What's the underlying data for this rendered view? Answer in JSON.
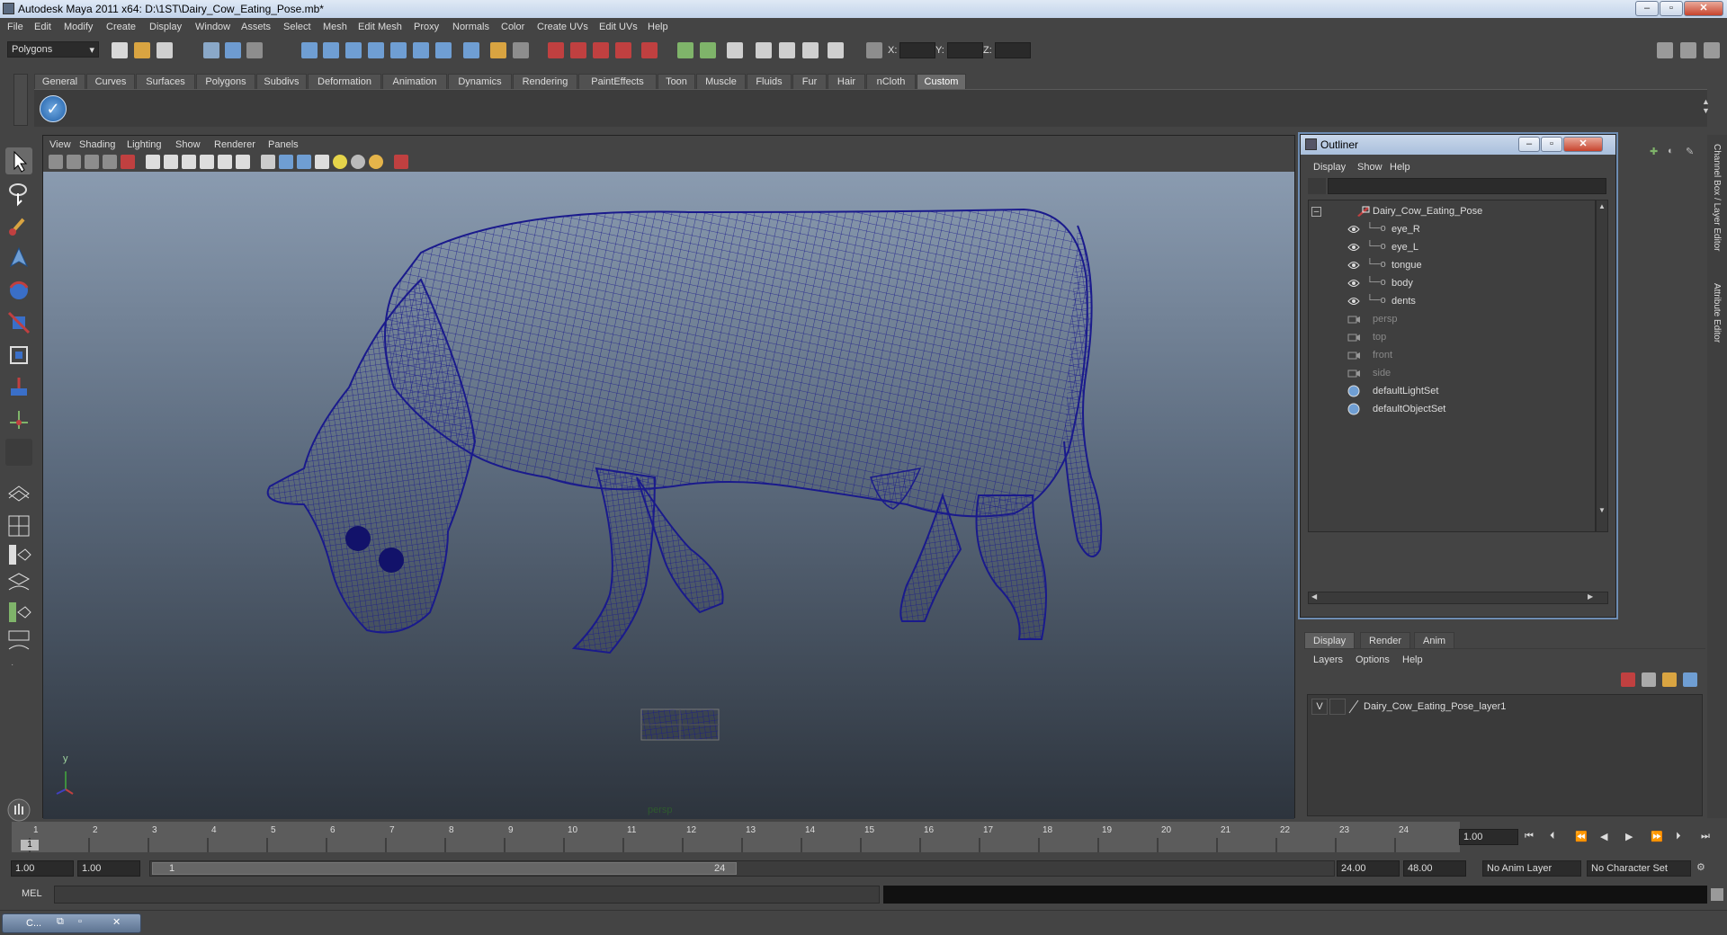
{
  "window": {
    "title": "Autodesk Maya 2011 x64: D:\\1ST\\Dairy_Cow_Eating_Pose.mb*"
  },
  "menubar": [
    "File",
    "Edit",
    "Modify",
    "Create",
    "Display",
    "Window",
    "Assets",
    "Select",
    "Mesh",
    "Edit Mesh",
    "Proxy",
    "Normals",
    "Color",
    "Create UVs",
    "Edit UVs",
    "Help"
  ],
  "status": {
    "mode": "Polygons",
    "x_label": "X:",
    "y_label": "Y:",
    "z_label": "Z:"
  },
  "shelf_tabs": [
    "General",
    "Curves",
    "Surfaces",
    "Polygons",
    "Subdivs",
    "Deformation",
    "Animation",
    "Dynamics",
    "Rendering",
    "PaintEffects",
    "Toon",
    "Muscle",
    "Fluids",
    "Fur",
    "Hair",
    "nCloth",
    "Custom"
  ],
  "shelf_active": "Custom",
  "viewport": {
    "menu": [
      "View",
      "Shading",
      "Lighting",
      "Show",
      "Renderer",
      "Panels"
    ],
    "camera_label": "persp",
    "axis_y": "y"
  },
  "outliner": {
    "title": "Outliner",
    "menu": [
      "Display",
      "Show",
      "Help"
    ],
    "items": [
      {
        "label": "Dairy_Cow_Eating_Pose",
        "indent": 0,
        "icon": "transform-icon",
        "dim": false
      },
      {
        "label": "eye_R",
        "indent": 1,
        "icon": "mesh-icon",
        "dim": false
      },
      {
        "label": "eye_L",
        "indent": 1,
        "icon": "mesh-icon",
        "dim": false
      },
      {
        "label": "tongue",
        "indent": 1,
        "icon": "mesh-icon",
        "dim": false
      },
      {
        "label": "body",
        "indent": 1,
        "icon": "mesh-icon",
        "dim": false
      },
      {
        "label": "dents",
        "indent": 1,
        "icon": "mesh-icon",
        "dim": false
      },
      {
        "label": "persp",
        "indent": 0,
        "icon": "camera-icon",
        "dim": true
      },
      {
        "label": "top",
        "indent": 0,
        "icon": "camera-icon",
        "dim": true
      },
      {
        "label": "front",
        "indent": 0,
        "icon": "camera-icon",
        "dim": true
      },
      {
        "label": "side",
        "indent": 0,
        "icon": "camera-icon",
        "dim": true
      },
      {
        "label": "defaultLightSet",
        "indent": 0,
        "icon": "set-icon",
        "dim": false
      },
      {
        "label": "defaultObjectSet",
        "indent": 0,
        "icon": "set-icon",
        "dim": false
      }
    ]
  },
  "layer_editor": {
    "tabs": [
      "Display",
      "Render",
      "Anim"
    ],
    "menu": [
      "Layers",
      "Options",
      "Help"
    ],
    "layer": {
      "visible": "V",
      "name": "Dairy_Cow_Eating_Pose_layer1"
    }
  },
  "side_labels": {
    "channel": "Channel Box / Layer Editor",
    "attr": "Attribute Editor"
  },
  "timeline": {
    "ticks": [
      "1",
      "2",
      "3",
      "4",
      "5",
      "6",
      "7",
      "8",
      "9",
      "10",
      "11",
      "12",
      "13",
      "14",
      "15",
      "16",
      "17",
      "18",
      "19",
      "20",
      "21",
      "22",
      "23",
      "24"
    ],
    "current_frame_marker": "1",
    "current_time": "1.00"
  },
  "range": {
    "start": "1.00",
    "playback_start": "1.00",
    "slider_start": "1",
    "slider_end": "24",
    "playback_end": "24.00",
    "end": "48.00",
    "anim_layer": "No Anim Layer",
    "char_set": "No Character Set"
  },
  "cmd": {
    "label": "MEL"
  },
  "taskbar": {
    "item": "C..."
  },
  "colors": {
    "wire": "#1a1a8c",
    "accent": "#6a6a6a"
  }
}
